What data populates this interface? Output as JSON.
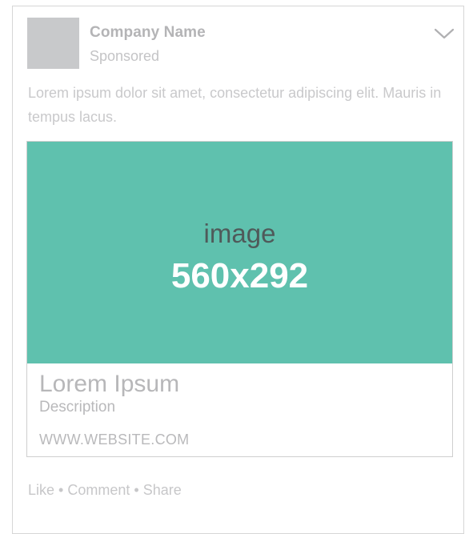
{
  "post": {
    "company_name": "Company Name",
    "sponsored_label": "Sponsored",
    "body_text": "Lorem ipsum dolor sit amet, consectetur adipiscing elit. Mauris in tempus lacus."
  },
  "link_preview": {
    "image_word": "image",
    "image_size": "560x292",
    "title": "Lorem Ipsum",
    "description": "Description",
    "url": "WWW.WEBSITE.COM"
  },
  "actions": {
    "like": "Like",
    "comment": "Comment",
    "share": "Share",
    "separator": "•"
  },
  "icons": {
    "menu": "chevron-down-icon"
  },
  "colors": {
    "image_background": "#5fc1ae",
    "avatar_placeholder": "#c8c9cb"
  }
}
